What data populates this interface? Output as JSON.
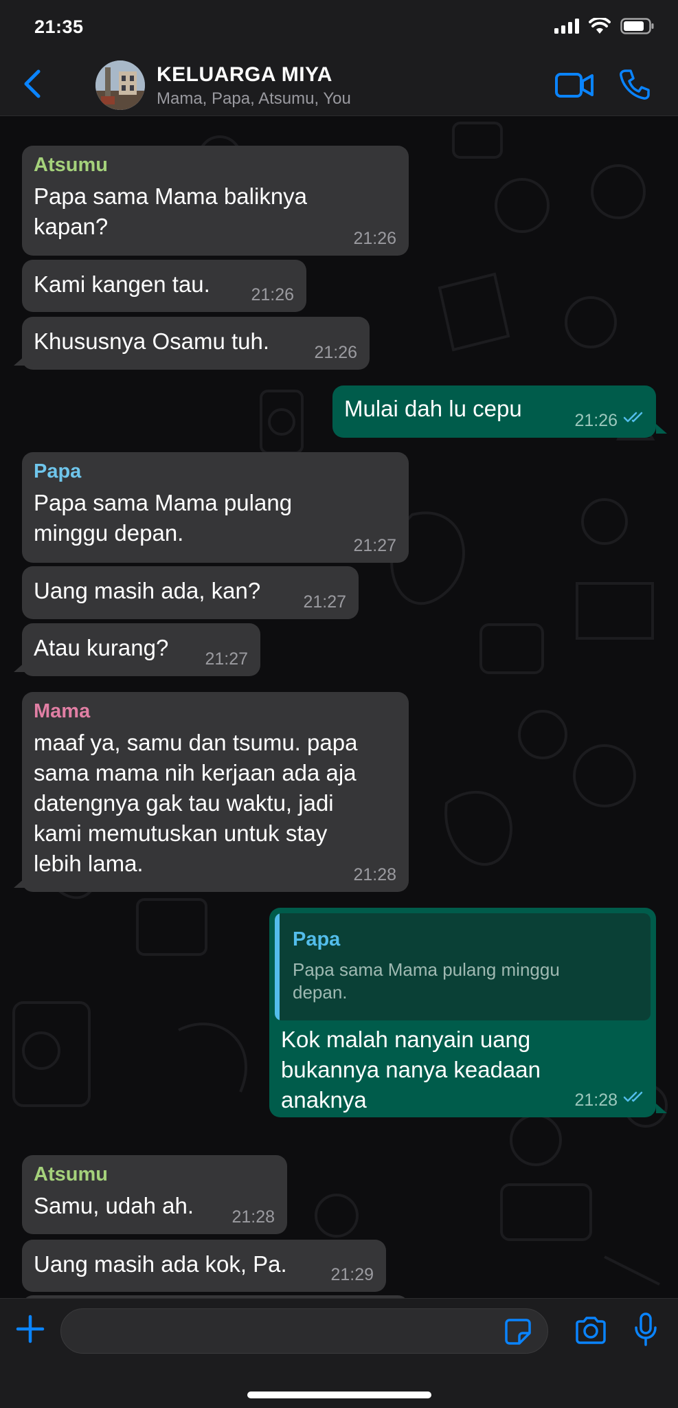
{
  "status_bar": {
    "time": "21:35"
  },
  "header": {
    "back_label": "",
    "group_name": "KELUARGA MIYA",
    "members": "Mama, Papa, Atsumu, You"
  },
  "colors": {
    "accent": "#0a84ff",
    "incoming_bubble": "#363638",
    "outgoing_bubble": "#005c4b",
    "sender_atsumu": "#a5d27b",
    "sender_papa": "#6fc6ec",
    "sender_mama": "#e17fa4",
    "read_ticks": "#53bdeb"
  },
  "messages": [
    {
      "sender": "Atsumu",
      "text": "Papa sama Mama baliknya\nkapan?",
      "time": "21:26"
    },
    {
      "text": "Kami kangen tau.",
      "time": "21:26"
    },
    {
      "text": "Khususnya Osamu tuh.",
      "time": "21:26"
    },
    {
      "text": "Mulai dah lu cepu",
      "time": "21:26"
    },
    {
      "sender": "Papa",
      "text": "Papa sama Mama pulang\nminggu depan.",
      "time": "21:27"
    },
    {
      "text": "Uang masih ada, kan?",
      "time": "21:27"
    },
    {
      "text": "Atau kurang?",
      "time": "21:27"
    },
    {
      "sender": "Mama",
      "text": "maaf ya, samu dan tsumu. papa\nsama mama nih kerjaan ada aja\ndatengnya gak tau waktu, jadi\nkami memutuskan untuk stay\nlebih lama.",
      "time": "21:28"
    },
    {
      "quote": {
        "sender": "Papa",
        "text": "Papa sama Mama pulang minggu\ndepan."
      },
      "text": "Kok malah nanyain uang\nbukannya nanya keadaan\nanaknya",
      "time": "21:28"
    },
    {
      "sender": "Atsumu",
      "text": "Samu, udah ah.",
      "time": "21:28"
    },
    {
      "text": "Uang masih ada kok, Pa.",
      "time": "21:29"
    }
  ],
  "input": {
    "placeholder": "",
    "value": ""
  },
  "icons": {
    "back": "chevron-left-icon",
    "video_call": "video-camera-icon",
    "voice_call": "phone-icon",
    "attach": "plus-icon",
    "sticker": "sticker-icon",
    "camera": "camera-icon",
    "microphone": "microphone-icon"
  }
}
